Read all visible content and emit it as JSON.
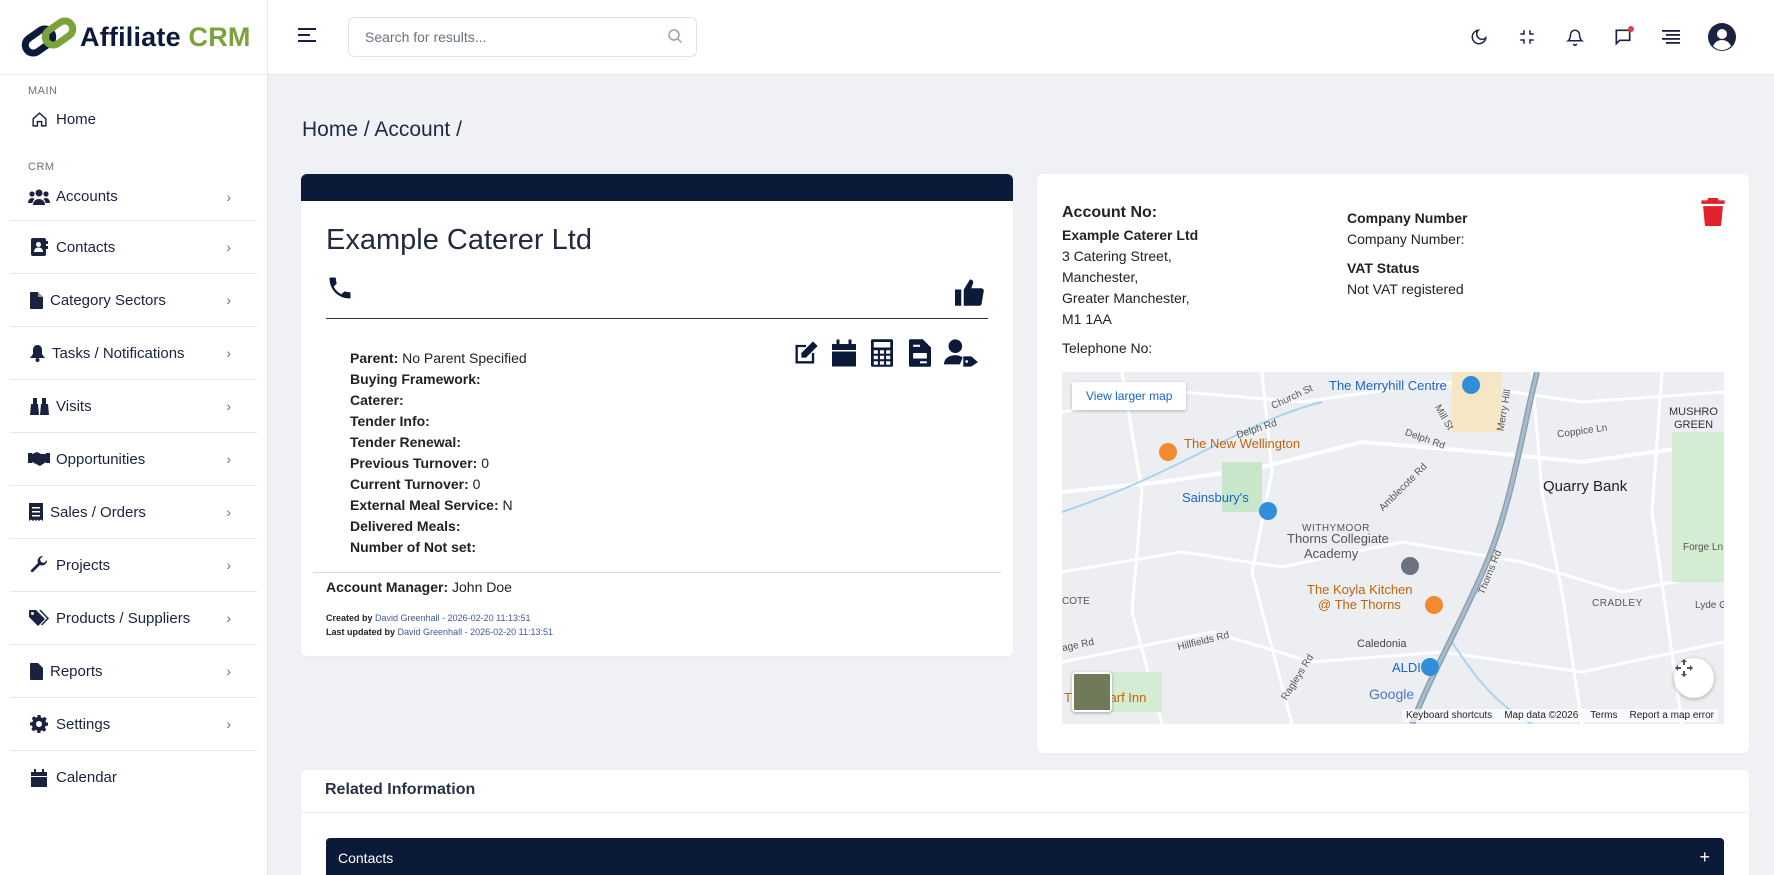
{
  "brand": {
    "word1": "Affiliate",
    "word2": "CRM",
    "dark": "#0c1a3a",
    "green": "#7ba33a"
  },
  "topbar": {
    "search_placeholder": "Search for results..."
  },
  "sidebar": {
    "section_main": "MAIN",
    "section_crm": "CRM",
    "home": "Home",
    "items": [
      {
        "label": "Accounts",
        "icon": "users-icon"
      },
      {
        "label": "Contacts",
        "icon": "address-book-icon"
      },
      {
        "label": "Category Sectors",
        "icon": "file-icon"
      },
      {
        "label": "Tasks / Notifications",
        "icon": "bell-icon"
      },
      {
        "label": "Visits",
        "icon": "binoculars-icon"
      },
      {
        "label": "Opportunities",
        "icon": "handshake-icon"
      },
      {
        "label": "Sales / Orders",
        "icon": "receipt-icon"
      },
      {
        "label": "Projects",
        "icon": "wrench-icon"
      },
      {
        "label": "Products / Suppliers",
        "icon": "tags-icon"
      },
      {
        "label": "Reports",
        "icon": "file-icon"
      },
      {
        "label": "Settings",
        "icon": "gear-icon"
      },
      {
        "label": "Calendar",
        "icon": "calendar-icon"
      }
    ]
  },
  "breadcrumb": "Home / Account /",
  "account": {
    "name": "Example Caterer Ltd",
    "details": [
      {
        "label": "Parent:",
        "value": "No Parent Specified"
      },
      {
        "label": "Buying Framework:",
        "value": ""
      },
      {
        "label": "Caterer:",
        "value": ""
      },
      {
        "label": "Tender Info:",
        "value": ""
      },
      {
        "label": "Tender Renewal:",
        "value": ""
      },
      {
        "label": "Previous Turnover:",
        "value": "0"
      },
      {
        "label": "Current Turnover:",
        "value": "0"
      },
      {
        "label": "External Meal Service:",
        "value": "N"
      },
      {
        "label": "Delivered Meals:",
        "value": ""
      },
      {
        "label": "Number of Not set:",
        "value": ""
      }
    ],
    "manager_label": "Account Manager:",
    "manager": "John Doe",
    "created_prefix": "Created by",
    "created_by": "David Greenhall",
    "created_at": "- 2026-02-20 11:13:51",
    "updated_prefix": "Last updated by",
    "updated_by": "David Greenhall",
    "updated_at": "- 2026-02-20 11:13:51"
  },
  "info": {
    "account_no_label": "Account No:",
    "company_name": "Example Caterer Ltd",
    "address": [
      "3 Catering Street,",
      "Manchester,",
      "Greater Manchester,",
      "M1 1AA"
    ],
    "telephone_label": "Telephone No:",
    "company_number_heading": "Company Number",
    "company_number_label": "Company Number:",
    "vat_heading": "VAT Status",
    "vat_value": "Not VAT registered"
  },
  "map": {
    "view_larger": "View larger map",
    "labels": {
      "merryhill": "The Merryhill Centre",
      "wellington": "The New Wellington",
      "sainsburys": "Sainsbury's",
      "withymoor": "WITHYMOOR",
      "quarry_bank": "Quarry Bank",
      "thorns1": "Thorns Collegiate",
      "thorns2": "Academy",
      "koyla1": "The Koyla Kitchen",
      "koyla2": "@ The Thorns",
      "cradley": "CRADLEY",
      "caledonia": "Caledonia",
      "aldi": "ALDI",
      "wharf": "The Wharf Inn",
      "mushroom1": "MUSHRO",
      "mushroom2": "GREEN",
      "coppice": "Coppice Ln",
      "church": "Church St",
      "delph1": "Delph Rd",
      "delph2": "Delph Rd",
      "mill": "Mill St",
      "amblecote": "Amblecote Rd",
      "thorns_rd": "Thorns Rd",
      "forge": "Forge Ln",
      "lyde": "Lyde G",
      "hillfields": "Hillfields Rd",
      "ragleys": "Ragleys Rd",
      "age": "age Rd",
      "cote": "COTE",
      "merry_hill_rd": "Merry Hill",
      "google": "Google"
    },
    "footer": [
      "Keyboard shortcuts",
      "Map data ©2026",
      "Terms",
      "Report a map error"
    ]
  },
  "related": {
    "title": "Related Information",
    "section": "Contacts",
    "expand": "+"
  }
}
